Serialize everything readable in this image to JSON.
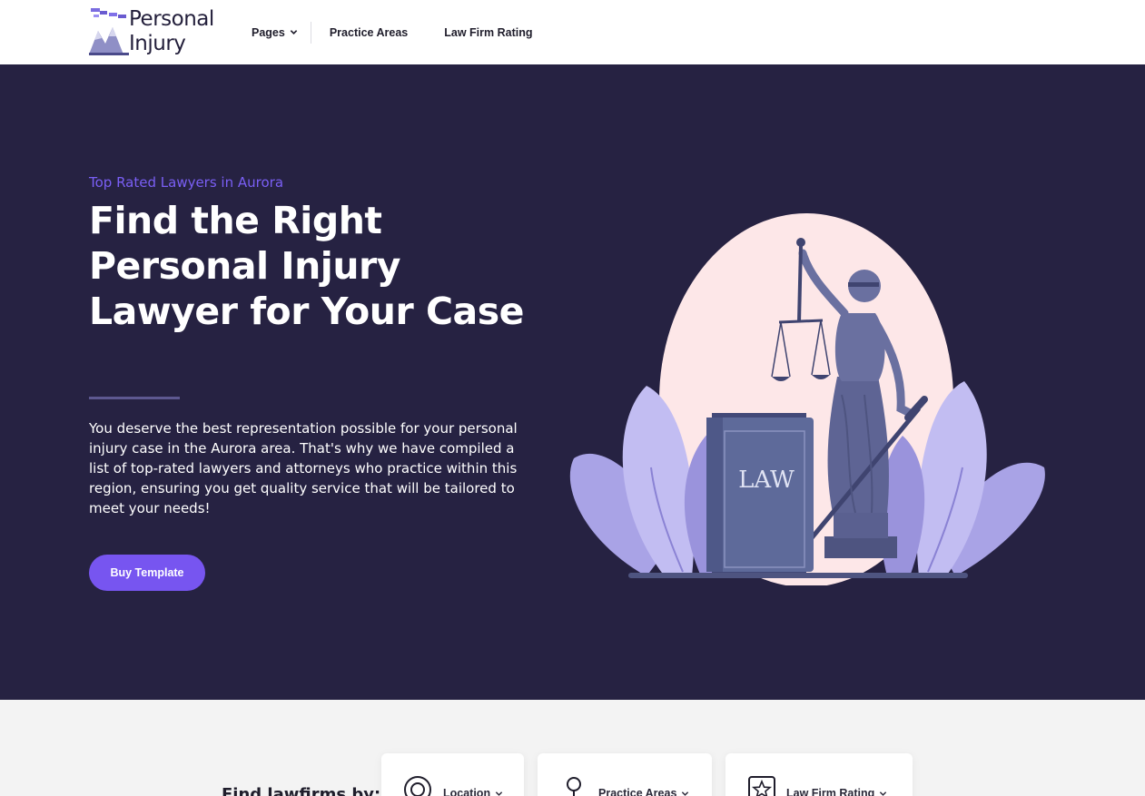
{
  "header": {
    "logo_line1": "Personal",
    "logo_line2": "Injury",
    "nav": {
      "pages": "Pages",
      "practice_areas": "Practice Areas",
      "law_firm_rating": "Law Firm Rating"
    }
  },
  "hero": {
    "eyebrow": "Top Rated Lawyers in Aurora",
    "headline": "Find the Right Personal Injury Lawyer for Your Case",
    "intro": "You deserve the best representation possible for your personal injury case in the Aurora area. That's why we have compiled a list of top-rated lawyers and attorneys who practice within this region, ensuring you get quality service that will be tailored to meet your needs!",
    "cta": "Buy Template",
    "book_text": "LAW"
  },
  "finder": {
    "label": "Find lawfirms by:",
    "filters": [
      {
        "label": "Location",
        "icon": "location-target-icon"
      },
      {
        "label": "Practice Areas",
        "icon": "practice-areas-icon"
      },
      {
        "label": "Law Firm Rating",
        "icon": "star-rating-icon"
      }
    ]
  },
  "colors": {
    "hero_bg": "#262242",
    "accent": "#7755f0",
    "eyebrow": "#7a5ff5",
    "illustration_figure": "#5e6494",
    "illustration_oval": "#fde7e8"
  }
}
